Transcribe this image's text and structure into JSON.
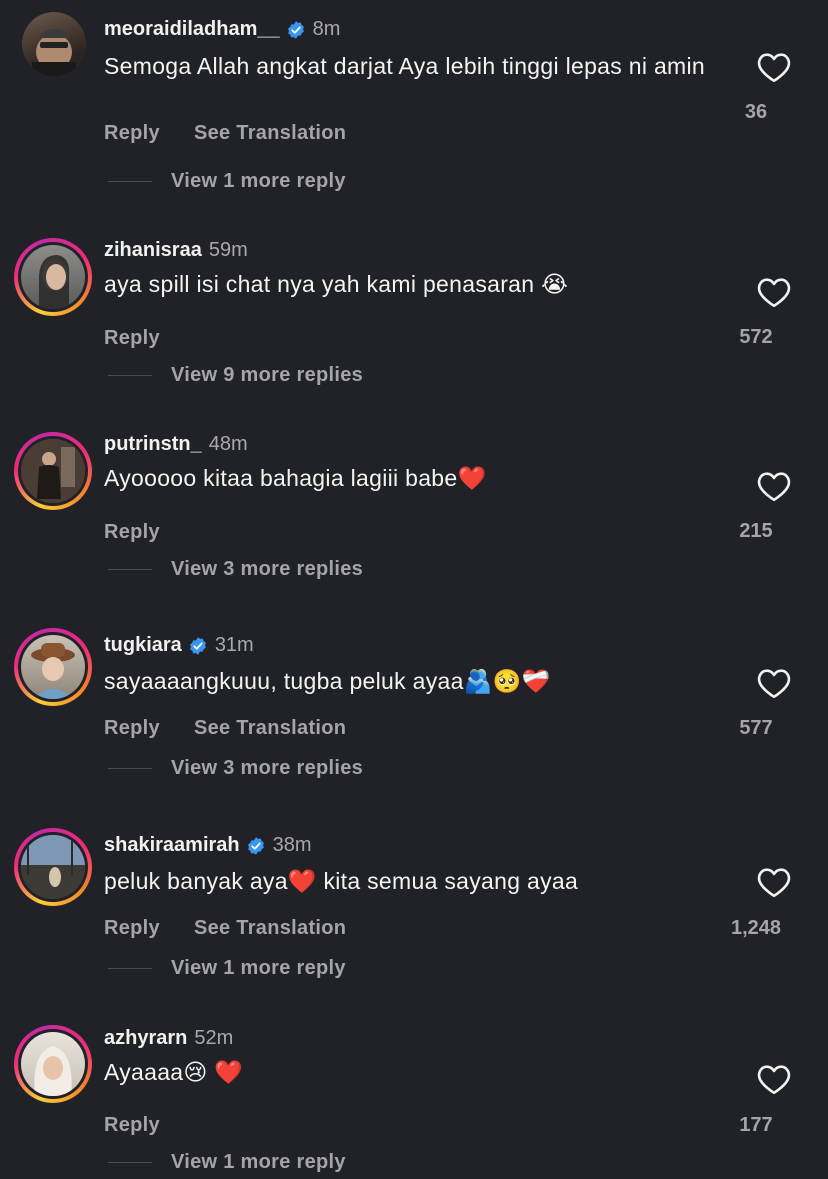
{
  "comments": [
    {
      "username": "meoraidiladham__",
      "verified": true,
      "time": "8m",
      "text": "Semoga Allah angkat darjat Aya lebih tinggi lepas ni amin",
      "reply_label": "Reply",
      "translation_label": "See Translation",
      "view_more": "View 1 more reply",
      "likes": "36"
    },
    {
      "username": "zihanisraa",
      "verified": false,
      "time": "59m",
      "text": "aya spill isi chat nya yah kami penasaran 😭",
      "reply_label": "Reply",
      "view_more": "View 9 more replies",
      "likes": "572"
    },
    {
      "username": "putrinstn_",
      "verified": false,
      "time": "48m",
      "text": "Ayooooo kitaa bahagia lagiii babe❤️",
      "reply_label": "Reply",
      "view_more": "View 3 more replies",
      "likes": "215"
    },
    {
      "username": "tugkiara",
      "verified": true,
      "time": "31m",
      "text": "sayaaaangkuuu, tugba peluk ayaa🫂🥺❤️‍🩹",
      "reply_label": "Reply",
      "translation_label": "See Translation",
      "view_more": "View 3 more replies",
      "likes": "577"
    },
    {
      "username": "shakiraamirah",
      "verified": true,
      "time": "38m",
      "text": "peluk banyak aya❤️ kita semua sayang ayaa",
      "reply_label": "Reply",
      "translation_label": "See Translation",
      "view_more": "View 1 more reply",
      "likes": "1,248"
    },
    {
      "username": "azhyrarn",
      "verified": false,
      "time": "52m",
      "text": "Ayaaaa😢 ❤️",
      "reply_label": "Reply",
      "view_more": "View 1 more reply",
      "likes": "177"
    }
  ],
  "icons": {
    "like": "heart-outline-icon",
    "verified": "verified-badge-icon"
  },
  "colors": {
    "background": "#212227",
    "verified": "#3797f0",
    "story_ring": "#ee2a7b"
  }
}
